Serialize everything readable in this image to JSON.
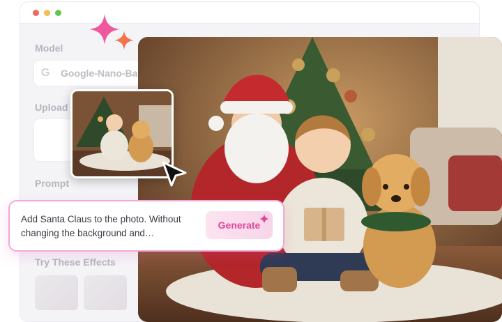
{
  "window": {
    "model_label": "Model",
    "model_value": "Google-Nano-Ba",
    "google_icon": "google-icon",
    "upload_label": "Upload",
    "prompt_label": "Prompt",
    "effects_label": "Try These Effects"
  },
  "prompt_card": {
    "text": "Add Santa Claus to the photo. Without changing the background and…",
    "generate_label": "Generate"
  },
  "colors": {
    "accent": "#e0479a",
    "sparkle_pink": "#f0579d",
    "sparkle_orange": "#f5734a"
  }
}
